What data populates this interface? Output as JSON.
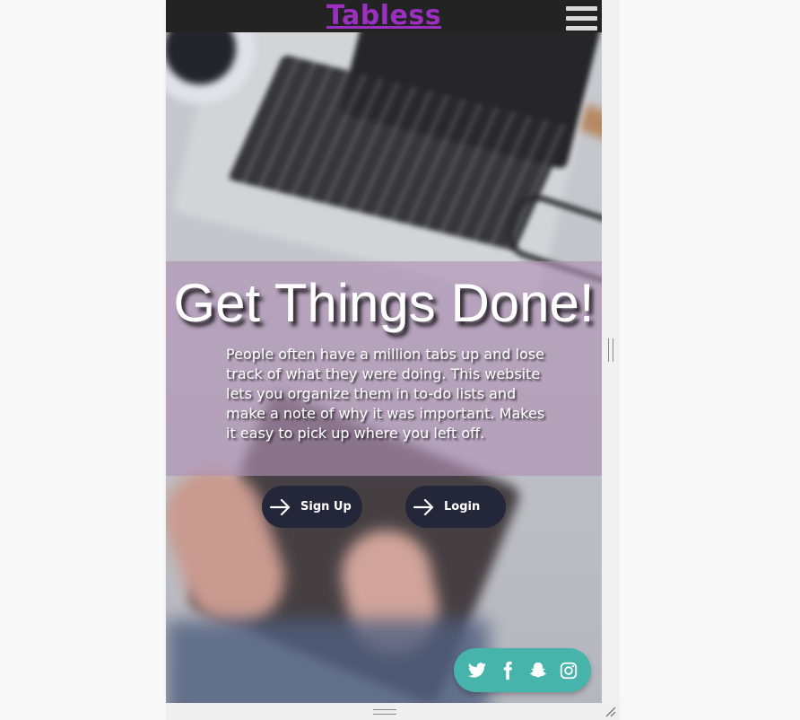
{
  "navbar": {
    "brand": "Tabless",
    "menu_icon": "hamburger-menu-icon"
  },
  "hero": {
    "headline": "Get Things Done!",
    "description": "People often have a million tabs up and lose track of what they were doing. This website lets you organize them in to-do lists and make a note of why it was important. Makes it easy to pick up where you left off."
  },
  "buttons": {
    "signup_label": "Sign Up",
    "login_label": "Login",
    "arrow_icon": "arrow-right-icon"
  },
  "social": {
    "icons": [
      "twitter-icon",
      "facebook-icon",
      "snapchat-icon",
      "instagram-icon"
    ]
  },
  "colors": {
    "navbar_bg": "#232323",
    "brand": "#9a2fc0",
    "hero_overlay": "#af91b4",
    "button_bg": "#24263a",
    "social_bg": "#46b4ab"
  }
}
